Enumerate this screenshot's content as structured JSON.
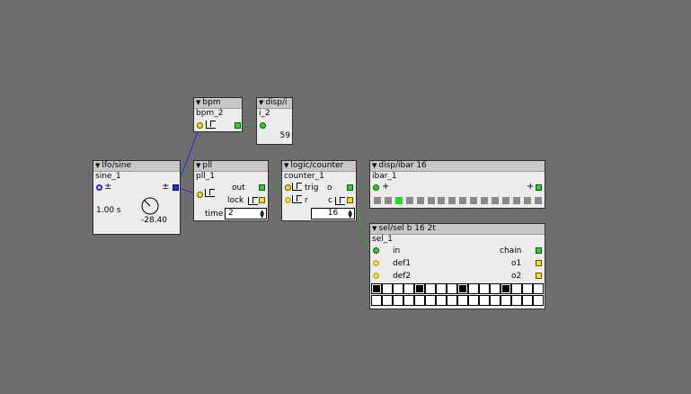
{
  "colors": {
    "canvas": "#6e6e6e",
    "wire_frac": "#1b2be0",
    "wire_int": "#2faa2f"
  },
  "bpm": {
    "type": "bpm",
    "instance": "bpm_2"
  },
  "disp_i": {
    "type": "disp/i",
    "instance": "i_2",
    "value": "59"
  },
  "lfo": {
    "type": "lfo/sine",
    "instance": "sine_1",
    "inlet_label": "±",
    "outlet_label": "±",
    "period": "1.00 s",
    "knob_value": "-28.40",
    "knob_icon": "knob-icon"
  },
  "pll": {
    "type": "pll",
    "instance": "pll_1",
    "out_label": "out",
    "lock_label": "lock",
    "time_label": "time",
    "time_value": "2"
  },
  "counter": {
    "type": "logic/counter",
    "instance": "counter_1",
    "trig_label": "trig",
    "r_label": "r",
    "o_label": "o",
    "c_label": "c",
    "value": "16"
  },
  "ibar": {
    "type": "disp/ibar 16",
    "instance": "ibar_1",
    "in_label": "+",
    "out_label": "+",
    "cells_lit": [
      2
    ]
  },
  "sel": {
    "type": "sel/sel b 16 2t",
    "instance": "sel_1",
    "inlets": [
      "in",
      "def1",
      "def2"
    ],
    "outlets": [
      "chain",
      "o1",
      "o2"
    ],
    "row1_on": [
      0,
      4,
      8,
      12
    ],
    "row2_on": []
  }
}
